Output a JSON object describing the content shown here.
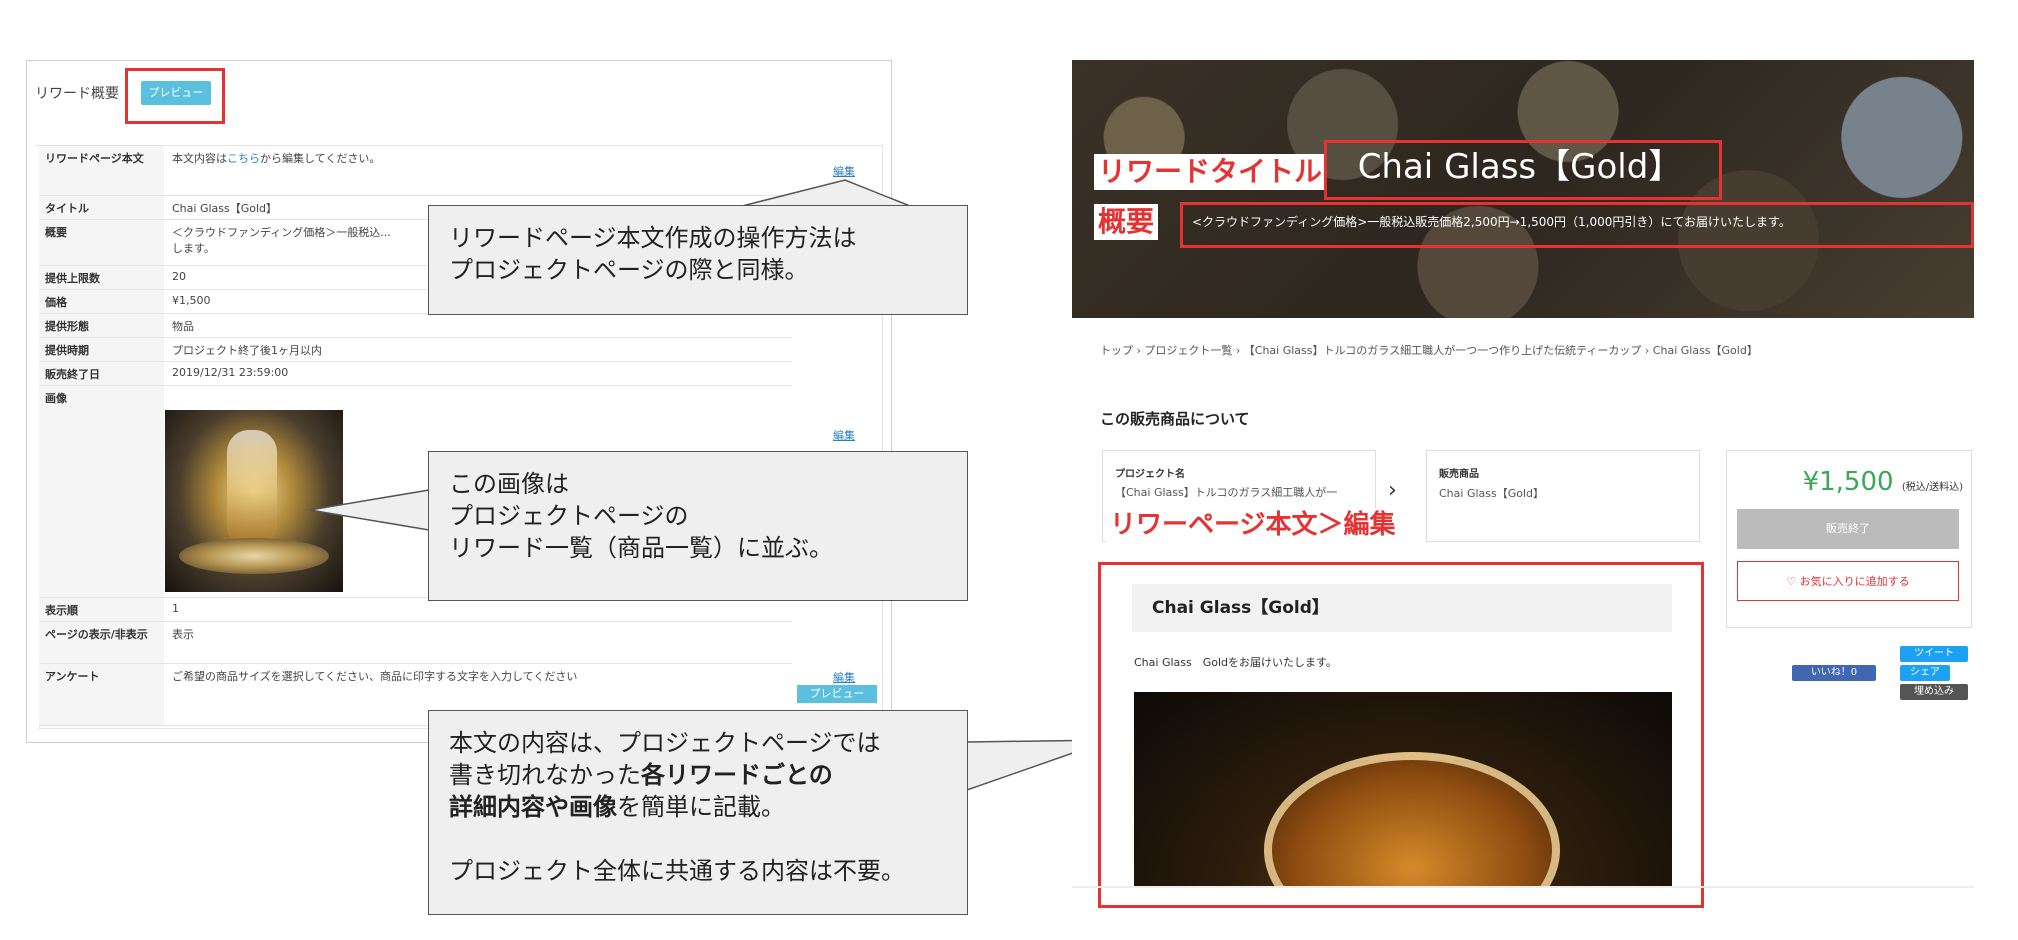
{
  "left": {
    "title": "リワード概要",
    "preview_button": "プレビュー",
    "rows": [
      {
        "label": "リワードページ本文",
        "value_pre": "本文内容は",
        "value_link": "こちら",
        "value_post": "から編集してください。"
      },
      {
        "label": "タイトル",
        "value": "Chai Glass【Gold】"
      },
      {
        "label": "概要",
        "value": "＜クラウドファンディング価格＞一般税込...\nします。"
      },
      {
        "label": "提供上限数",
        "value": "20"
      },
      {
        "label": "価格",
        "value": "¥1,500"
      },
      {
        "label": "提供形態",
        "value": "物品"
      },
      {
        "label": "提供時期",
        "value": "プロジェクト終了後1ヶ月以内"
      },
      {
        "label": "販売終了日",
        "value": "2019/12/31 23:59:00"
      },
      {
        "label": "画像",
        "value": ""
      },
      {
        "label": "表示順",
        "value": "1"
      },
      {
        "label": "ページの表示/非表示",
        "value": "表示"
      },
      {
        "label": "アンケート",
        "value": "ご希望の商品サイズを選択してください、商品に印字する文字を入力してください"
      }
    ],
    "edit_label": "編集",
    "anq_preview": "プレビュー"
  },
  "callouts": {
    "c1": "リワードページ本文作成の操作方法は\nプロジェクトページの際と同様。",
    "c2": "この画像は\nプロジェクトページの\nリワード一覧（商品一覧）に並ぶ。",
    "c3_a": "本文の内容は、プロジェクトページでは\n書き切れなかった",
    "c3_b": "各リワードごとの\n詳細内容や画像",
    "c3_c": "を簡単に記載。\n\nプロジェクト全体に共通する内容は不要。"
  },
  "right": {
    "reward_title_label": "リワードタイトル",
    "reward_title": "Chai Glass【Gold】",
    "summary_label": "概要",
    "summary": "<クラウドファンディング価格>一般税込販売価格2,500円→1,500円（1,000円引き）にてお届けいたします。",
    "breadcrumb": "トップ › プロジェクト一覧 › 【Chai Glass】トルコのガラス細工職人が一つ一つ作り上げた伝統ティーカップ › Chai Glass【Gold】",
    "about_heading": "この販売商品について",
    "project_label": "プロジェクト名",
    "project_name": "【Chai Glass】トルコのガラス細工職人が一",
    "chevron": "›",
    "item_label": "販売商品",
    "item_name": "Chai Glass【Gold】",
    "red_annotation": "リワーページ本文＞編集",
    "price": "¥1,500",
    "price_note": "(税込/送料込)",
    "sold_out": "販売終了",
    "favorite": "♡  お気に入りに追加する",
    "tweet": "ツイート",
    "like": "いいね！0",
    "share": "シェア",
    "embed": "埋め込み",
    "body_title": "Chai Glass【Gold】",
    "body_text": "Chai Glass　Goldをお届けいたします。"
  },
  "colors": {
    "highlight": "#e53333",
    "preview_button": "#5bc0de",
    "price": "#3aa856"
  }
}
